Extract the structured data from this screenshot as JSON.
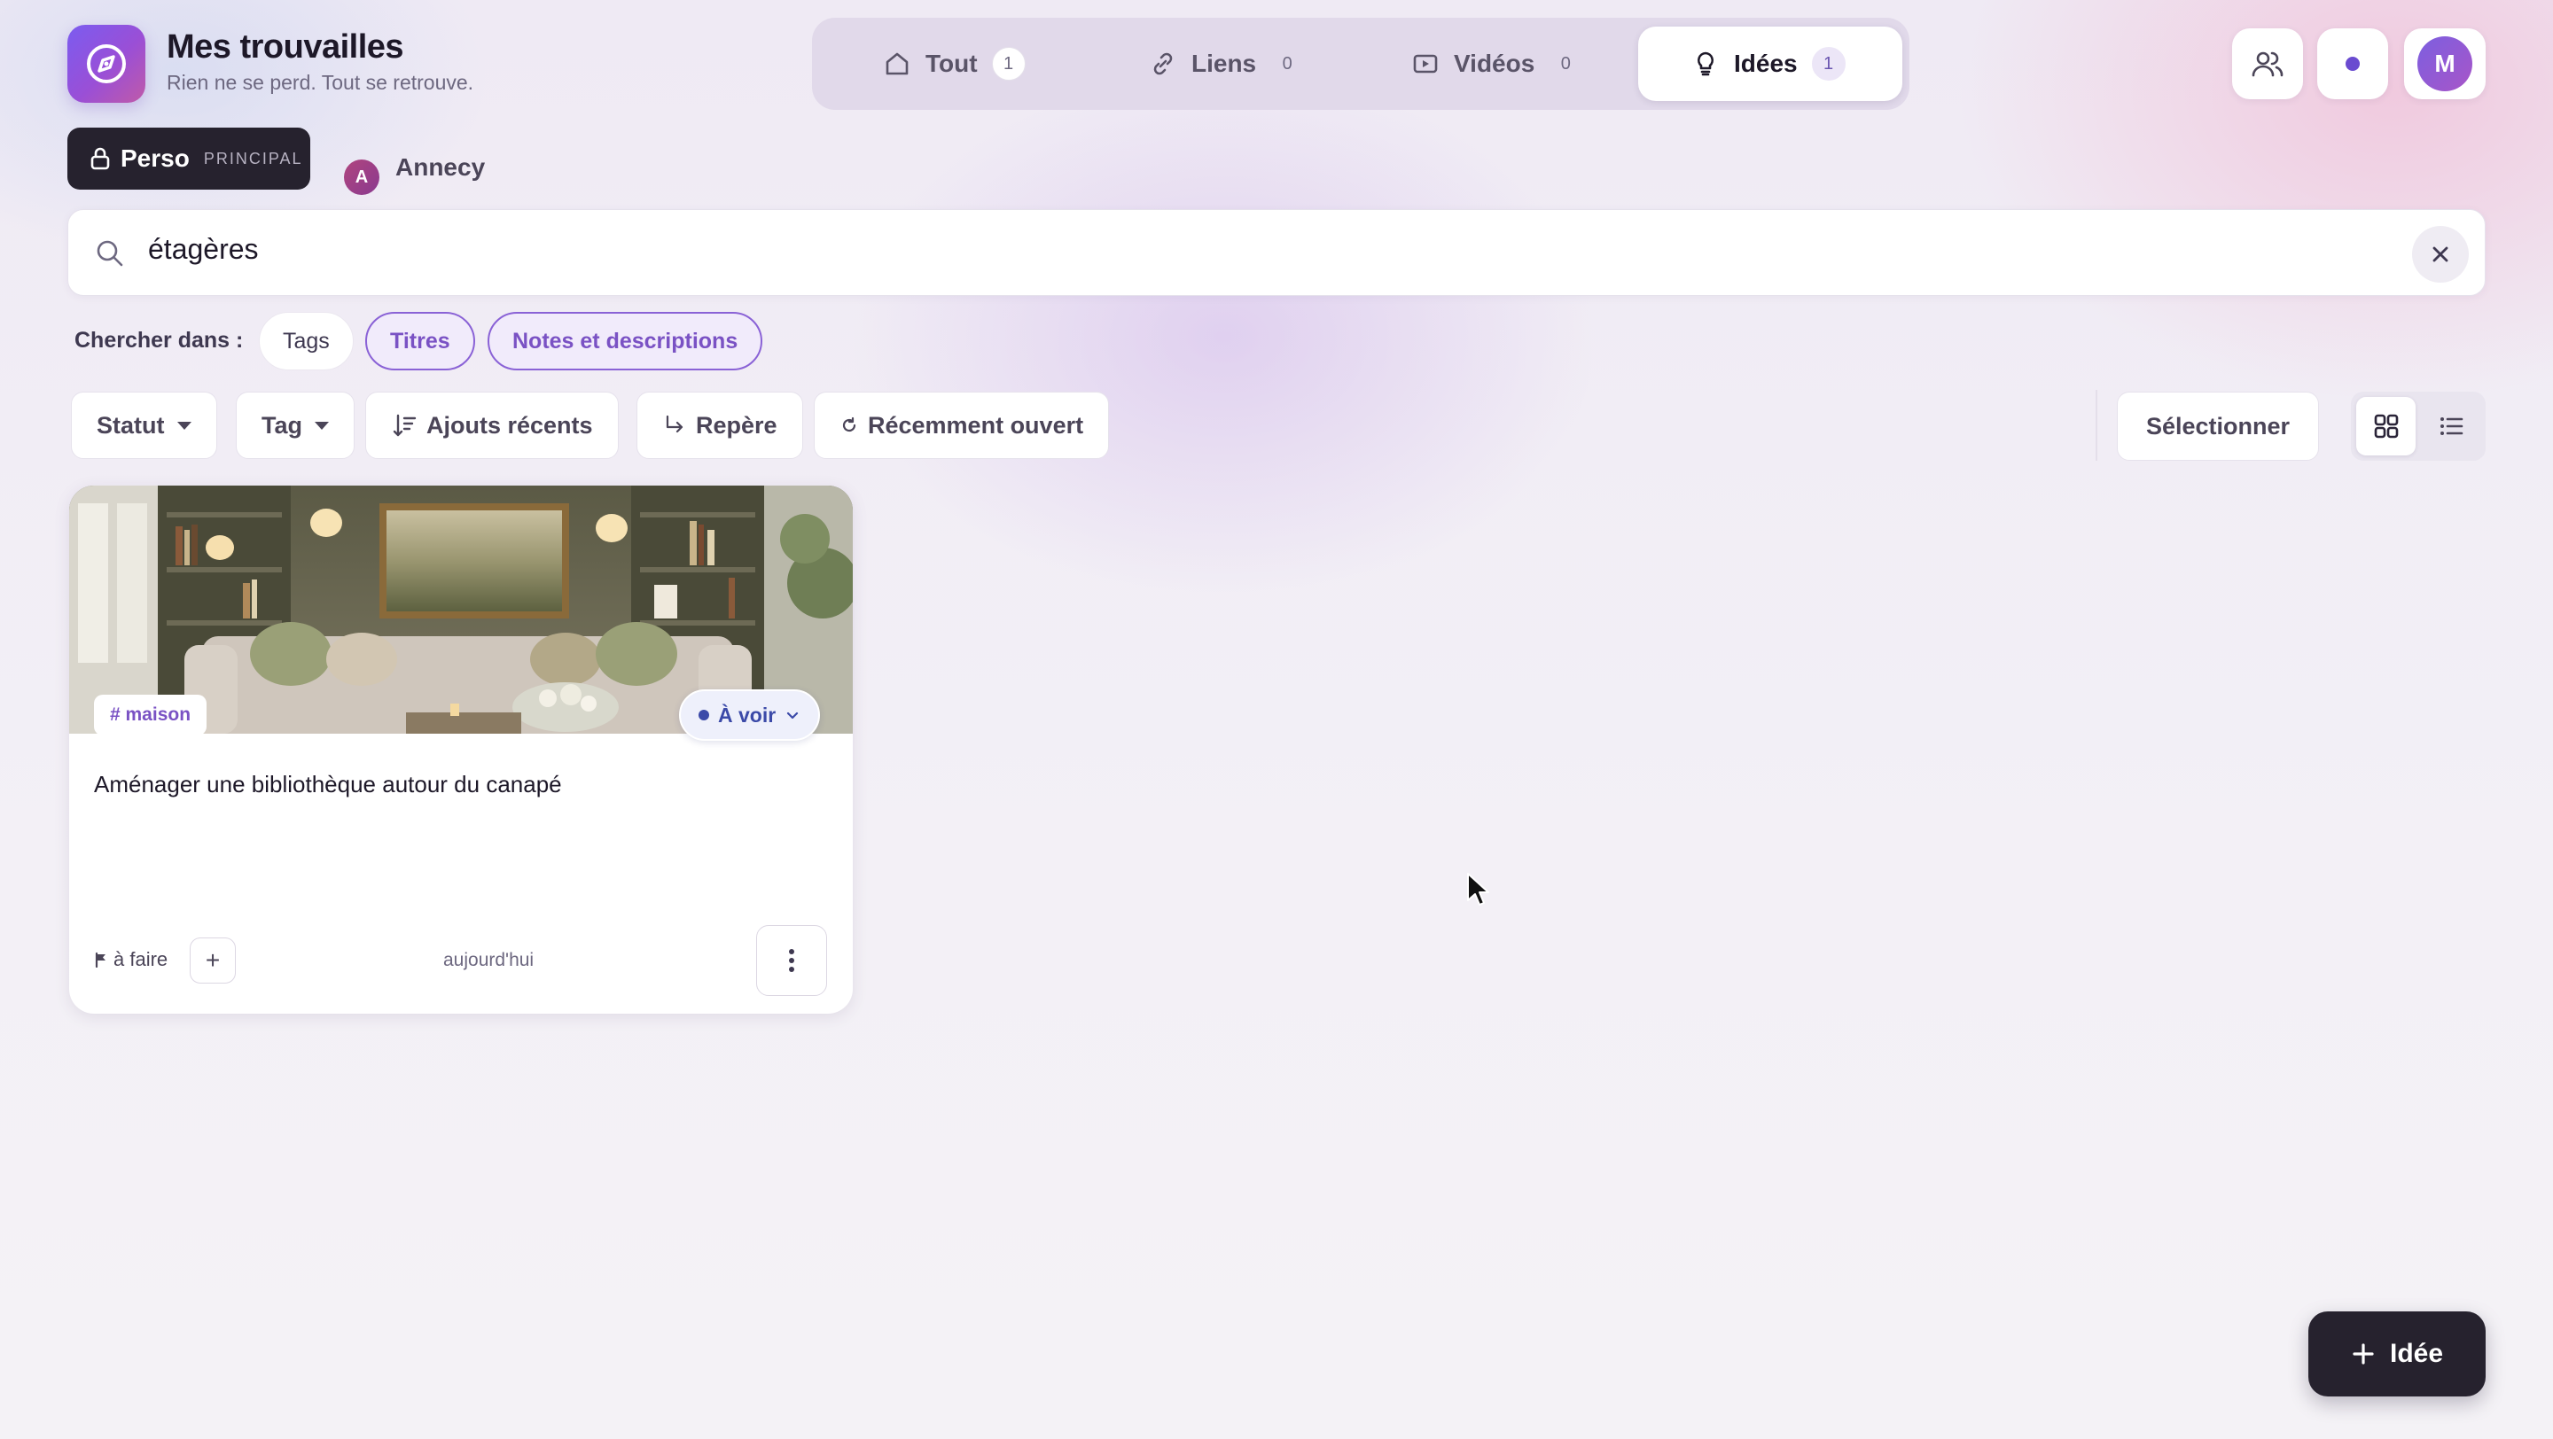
{
  "brand": {
    "title": "Mes trouvailles",
    "subtitle": "Rien ne se perd. Tout se retrouve."
  },
  "tabs": [
    {
      "label": "Tout",
      "count": "1",
      "icon": "home-icon",
      "active": false
    },
    {
      "label": "Liens",
      "count": "0",
      "icon": "link-icon",
      "active": false
    },
    {
      "label": "Vidéos",
      "count": "0",
      "icon": "video-icon",
      "active": false
    },
    {
      "label": "Idées",
      "count": "1",
      "icon": "lightbulb-icon",
      "active": true
    }
  ],
  "header_actions": {
    "avatar_initial": "M"
  },
  "workspaces": {
    "perso": {
      "name": "Perso",
      "badge": "PRINCIPAL"
    },
    "annecy": {
      "initial": "A",
      "name": "Annecy"
    }
  },
  "search": {
    "value": "étagères"
  },
  "search_in": {
    "label": "Chercher dans :",
    "options": [
      {
        "label": "Tags",
        "selected": false
      },
      {
        "label": "Titres",
        "selected": true
      },
      {
        "label": "Notes et descriptions",
        "selected": true
      }
    ]
  },
  "filters": {
    "status": "Statut",
    "tag": "Tag",
    "sort": "Ajouts récents",
    "bookmark": "Repère",
    "recent": "Récemment ouvert",
    "select": "Sélectionner"
  },
  "cards": [
    {
      "tag": "# maison",
      "status": "À voir",
      "title": "Aménager une bibliothèque autour du canapé",
      "flag": "à faire",
      "date": "aujourd'hui"
    }
  ],
  "fab": {
    "label": "Idée"
  },
  "colors": {
    "accent": "#7a52c4",
    "dark": "#26222e",
    "status_blue": "#3b4aa8"
  }
}
